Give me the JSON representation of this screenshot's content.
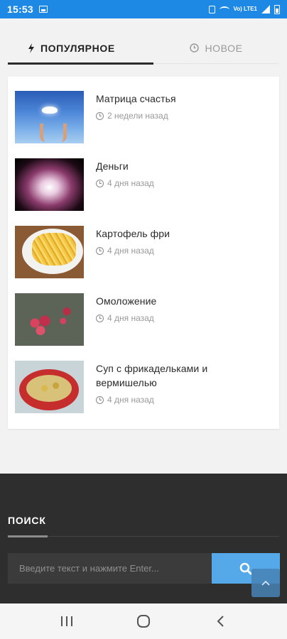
{
  "status_bar": {
    "time": "15:53",
    "icons": [
      "gallery-icon",
      "alarm-icon",
      "wifi-icon",
      "volte-icon",
      "signal-icon",
      "battery-icon"
    ],
    "volte_text": "Vo) LTE1"
  },
  "tabs": [
    {
      "label": "ПОПУЛЯРНОЕ",
      "icon": "bolt-icon",
      "active": true
    },
    {
      "label": "НОВОЕ",
      "icon": "clock-icon",
      "active": false
    }
  ],
  "articles": [
    {
      "title": "Матрица счастья",
      "time": "2 недели назад",
      "thumb": "sky-hands-dove"
    },
    {
      "title": "Деньги",
      "time": "4 дня назад",
      "thumb": "glowing-hands"
    },
    {
      "title": "Картофель фри",
      "time": "4 дня назад",
      "thumb": "french-fries"
    },
    {
      "title": "Омоложение",
      "time": "4 дня назад",
      "thumb": "red-flowers"
    },
    {
      "title": "Суп с фрикадельками и вермишелью",
      "time": "4 дня назад",
      "thumb": "soup-bowl"
    }
  ],
  "footer": {
    "search_title": "ПОИСК",
    "search_placeholder": "Введите текст и нажмите Enter...",
    "search_value": ""
  },
  "colors": {
    "status_bar": "#1e88e5",
    "search_button": "#56a9e9",
    "footer_bg": "#2e2e2e",
    "accent_underline": "#2b2b2b"
  },
  "navbar": {
    "buttons": [
      "recent-apps-icon",
      "home-icon",
      "back-icon"
    ]
  }
}
